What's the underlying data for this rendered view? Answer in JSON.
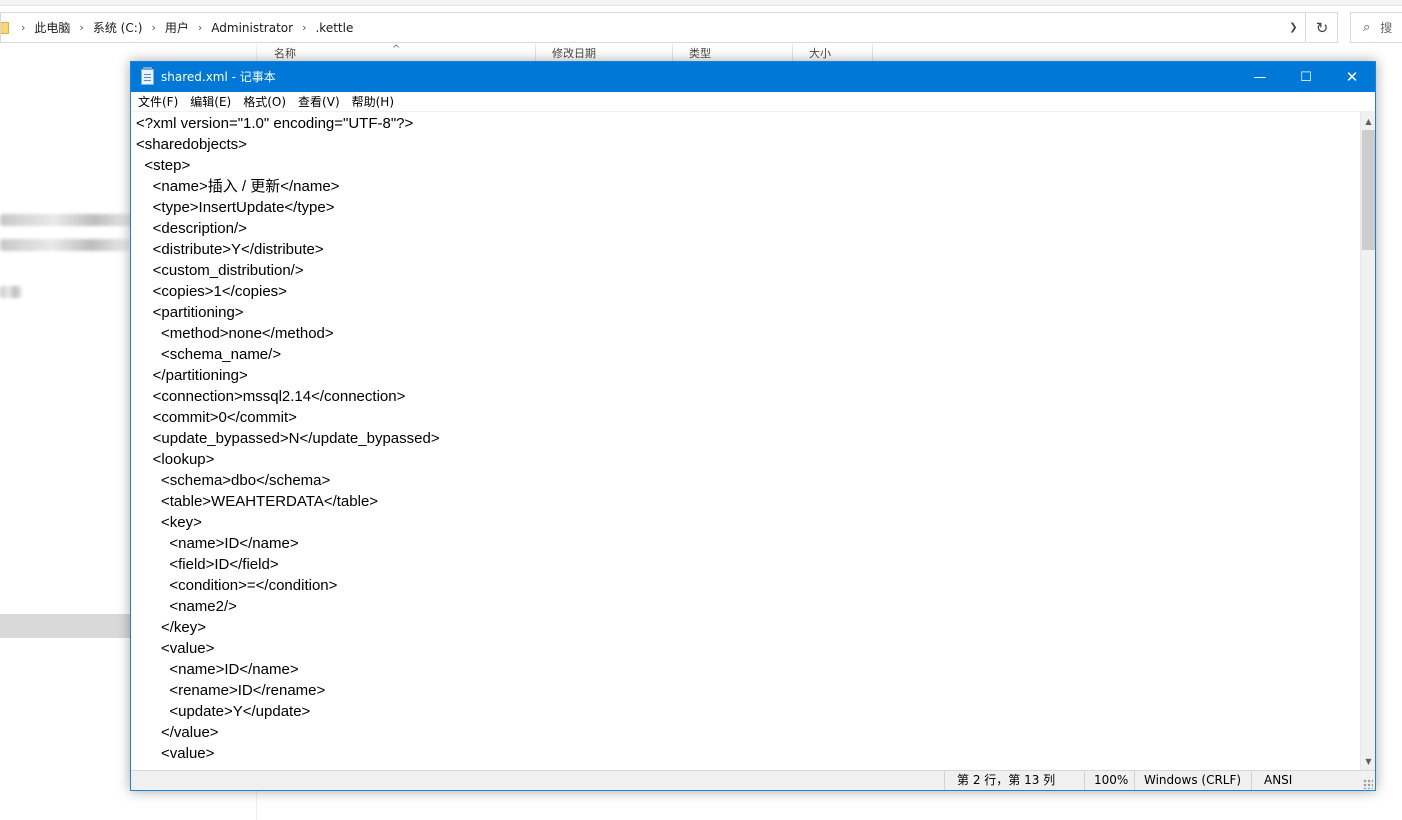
{
  "explorer": {
    "breadcrumbs": [
      "此电脑",
      "系统 (C:)",
      "用户",
      "Administrator",
      ".kettle"
    ],
    "search_placeholder": "搜",
    "columns": [
      "名称",
      "修改日期",
      "类型",
      "大小"
    ]
  },
  "notepad": {
    "title": "shared.xml - 记事本",
    "menu": [
      "文件(F)",
      "编辑(E)",
      "格式(O)",
      "查看(V)",
      "帮助(H)"
    ],
    "lines": [
      "<?xml version=\"1.0\" encoding=\"UTF-8\"?>",
      "<sharedobjects>",
      "  <step>",
      "    <name>插入 / 更新</name>",
      "    <type>InsertUpdate</type>",
      "    <description/>",
      "    <distribute>Y</distribute>",
      "    <custom_distribution/>",
      "    <copies>1</copies>",
      "    <partitioning>",
      "      <method>none</method>",
      "      <schema_name/>",
      "    </partitioning>",
      "    <connection>mssql2.14</connection>",
      "    <commit>0</commit>",
      "    <update_bypassed>N</update_bypassed>",
      "    <lookup>",
      "      <schema>dbo</schema>",
      "      <table>WEAHTERDATA</table>",
      "      <key>",
      "        <name>ID</name>",
      "        <field>ID</field>",
      "        <condition>=</condition>",
      "        <name2/>",
      "      </key>",
      "      <value>",
      "        <name>ID</name>",
      "        <rename>ID</rename>",
      "        <update>Y</update>",
      "      </value>",
      "      <value>"
    ],
    "status": {
      "position": "第 2 行，第 13 列",
      "zoom": "100%",
      "line_ending": "Windows (CRLF)",
      "encoding": "ANSI"
    }
  },
  "colors": {
    "title_bar": "#0078d7",
    "status_bar": "#f0f0f0"
  }
}
